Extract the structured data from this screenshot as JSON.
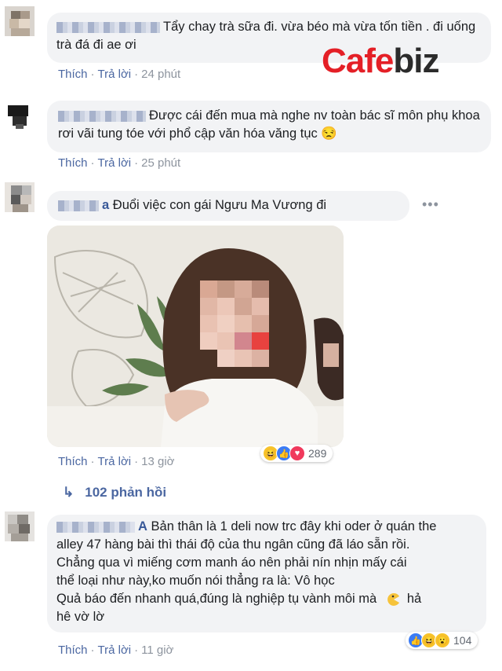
{
  "brand": {
    "logo_part1": "Cafe",
    "logo_part2": "biz",
    "accent": "#e41f26"
  },
  "action_labels": {
    "like": "Thích",
    "reply": "Trả lời",
    "sep": "·"
  },
  "comments": [
    {
      "text": "Tẩy chay trà sữa đi. vừa béo mà vừa tốn tiền . đi uống trà đá đi ae ơi",
      "name_hint": "",
      "time": "24 phút"
    },
    {
      "text": "Được cái đến mua mà nghe nv toàn bác sĩ môn phụ khoa rơi vãi tung tóe với phổ cập văn hóa văng tục",
      "name_hint": "",
      "emoji": "😒",
      "time": "25 phút"
    },
    {
      "text": "Đuổi việc con gái Ngưu Ma Vương đi",
      "name_hint": "a",
      "time": "13 giờ",
      "reaction_count": "289",
      "replies": "102 phản hồi"
    },
    {
      "name_hint": "A",
      "line1": "Bản thân là 1 deli now trc đây khi oder ở quán the",
      "line2": "alley 47 hàng bài thì thái độ của thu ngân cũng đã láo sẵn rồi.",
      "line3": "Chẳng qua vì miếng cơm manh áo nên phải nín nhịn mấy cái",
      "line4": "thể loại như này,ko muốn nói thẳng ra là: Vô học",
      "line5": "Quả báo đến nhanh quá,đúng là nghiệp tụ vành môi mà",
      "line5b": "hả",
      "line6": "hê vờ lờ",
      "time": "11 giờ",
      "reaction_count": "104"
    }
  ],
  "icons": [
    "more-icon",
    "like-icon",
    "haha-icon",
    "love-icon",
    "wow-icon",
    "reply-arrow-icon"
  ],
  "reaction_colors": {
    "like": "#3b7cf5",
    "haha": "#f7c32a",
    "love": "#f0395c"
  }
}
